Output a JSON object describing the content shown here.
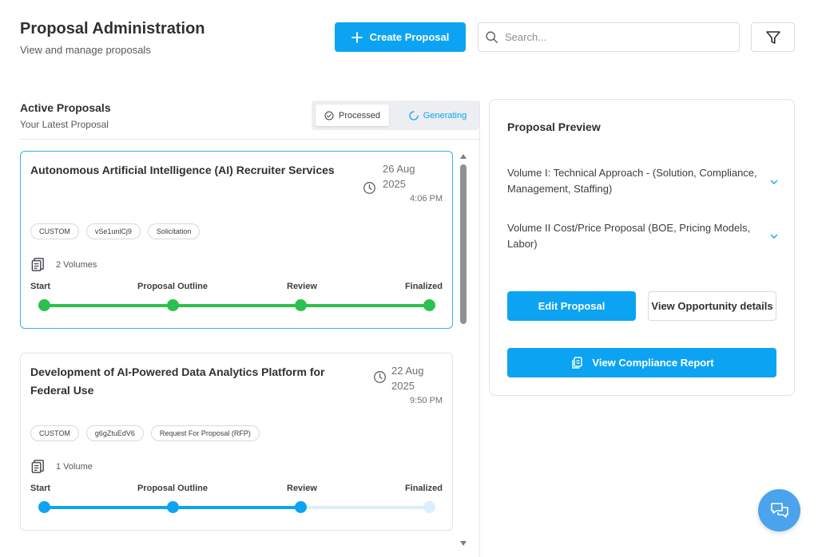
{
  "header": {
    "title": "Proposal Administration",
    "subtitle": "View and manage proposals",
    "create_label": "Create Proposal",
    "search_placeholder": "Search..."
  },
  "active": {
    "title": "Active Proposals",
    "subtitle": "Your Latest Proposal",
    "toggle": {
      "processed": "Processed",
      "generating": "Generating",
      "selected": "Processed"
    }
  },
  "stage_labels": [
    "Start",
    "Proposal Outline",
    "Review",
    "Finalized"
  ],
  "proposals": [
    {
      "title": "Autonomous Artificial Intelligence (AI) Recruiter Services",
      "date_day": "26 Aug",
      "date_year": "2025",
      "time": "4:06 PM",
      "tags": [
        "CUSTOM",
        "vSe1unlCj9",
        "Solicitation"
      ],
      "volumes": "2 Volumes",
      "stages_completed": 4
    },
    {
      "title": "Development of AI-Powered Data Analytics Platform for Federal Use",
      "date_day": "22 Aug",
      "date_year": "2025",
      "time": "9:50 PM",
      "tags": [
        "CUSTOM",
        "g6gZtuEdV6",
        "Request For Proposal (RFP)"
      ],
      "volumes": "1 Volume",
      "stages_completed": 3
    }
  ],
  "preview": {
    "title": "Proposal Preview",
    "volumes": [
      "Volume I: Technical Approach - (Solution, Compliance, Management, Staffing)",
      "Volume II Cost/Price Proposal (BOE, Pricing Models, Labor)"
    ],
    "edit_label": "Edit Proposal",
    "opportunity_label": "View Opportunity details",
    "compliance_label": "View Compliance Report"
  },
  "colors": {
    "primary": "#0ca4f2",
    "complete": "#2cc04f",
    "progress": "#0ca4f2",
    "pending": "#dbeefc",
    "selected_border": "#34b2ee"
  },
  "icons": {
    "create": "plus-icon",
    "search": "search-icon",
    "filter": "filter-icon",
    "processed": "check-circle-icon",
    "generating": "spinner-icon",
    "date": "clock-icon",
    "volumes": "document-stack-icon",
    "volume_toggle": "chevron-down-icon",
    "compliance": "copy-icon",
    "chat": "chat-icon"
  }
}
